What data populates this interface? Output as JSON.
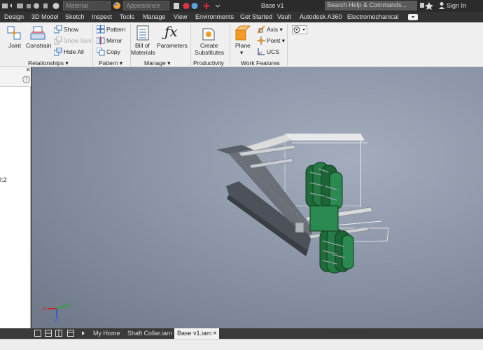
{
  "titlebar": {
    "material": "Material",
    "appearance": "Appearance",
    "doc_title": "Base v1",
    "search_placeholder": "Search Help & Commands...",
    "sign_in": "Sign In"
  },
  "menu": [
    "Design",
    "3D Model",
    "Sketch",
    "Inspect",
    "Tools",
    "Manage",
    "View",
    "Environments",
    "Get Started",
    "Vault",
    "Autodesk A360",
    "Electromechanical"
  ],
  "ribbon": {
    "joint": "Joint",
    "constrain": "Constrain",
    "show": "Show",
    "show_sick": "Show Sick",
    "hide_all": "Hide All",
    "relationships": "Relationships",
    "pattern": "Pattern",
    "mirror": "Mirror",
    "copy": "Copy",
    "pattern_panel": "Pattern",
    "bom_line1": "Bill of",
    "bom_line2": "Materials",
    "parameters": "Parameters",
    "manage_panel": "Manage",
    "create_line1": "Create",
    "create_line2": "Substitutes",
    "productivity_panel": "Productivity",
    "plane": "Plane",
    "axis": "Axis",
    "point": "Point",
    "ucs": "UCS",
    "work_features_panel": "Work Features"
  },
  "browser": {
    "partial_text": "l:2"
  },
  "tabs": [
    "My Home",
    "Shaft Collar.iam",
    "Base v1.iam"
  ],
  "colors": {
    "accent_red": "#d11f2a",
    "wheel_green": "#1f6b3a"
  }
}
